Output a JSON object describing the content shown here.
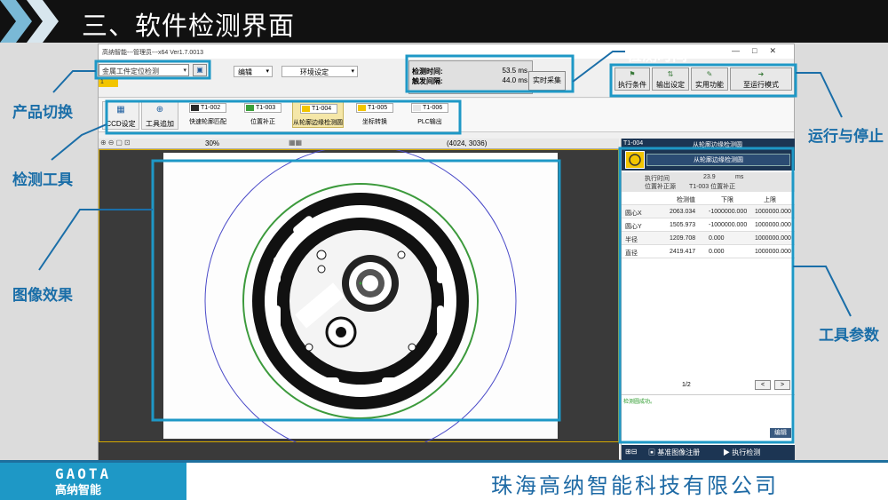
{
  "slide": {
    "title": "三、软件检测界面",
    "company": "珠海高纳智能科技有限公司",
    "logo_en": "GAOTA",
    "logo_cn": "高纳智能"
  },
  "annotations": {
    "product_switch": "产品切换",
    "detection_tools": "检测工具",
    "image_effect": "图像效果",
    "detection_time": "检测时间",
    "run_stop": "运行与停止",
    "tool_params": "工具参数"
  },
  "window": {
    "title": "高纳智能---管理员---x64 Ver1.7.0013",
    "controls": [
      "—",
      "□",
      "✕"
    ]
  },
  "toolbar": {
    "product_value": "金属工件定位检测",
    "badge": "1",
    "edit_menu": "编辑",
    "env_menu": "环境设定",
    "detect_time_label": "检测时间:",
    "detect_time_value": "53.5 ms",
    "trigger_label": "触发间隔:",
    "trigger_value": "44.0 ms",
    "realtime_btn": "实时采集",
    "run_buttons": [
      "执行条件",
      "输出设定",
      "实用功能",
      "至运行模式"
    ]
  },
  "tools": {
    "ccd": "CCD设定",
    "add": "工具追加",
    "items": [
      {
        "id": "T1-002",
        "name": "快速轮廓匹配",
        "color": "#2a2a2a"
      },
      {
        "id": "T1-003",
        "name": "位置补正",
        "color": "#3aa03a"
      },
      {
        "id": "T1-004",
        "name": "从轮廓边缘检测圆",
        "color": "#f2c500"
      },
      {
        "id": "T1-005",
        "name": "坐标转换",
        "color": "#f2c500"
      },
      {
        "id": "T1-006",
        "name": "PLC输出",
        "color": "#e8e8e8"
      }
    ]
  },
  "image": {
    "zoom": "30%",
    "coords": "(4024, 3036)"
  },
  "panel": {
    "head_id": "T1-004",
    "head_title": "从轮廓边缘检测圆",
    "tool_name": "从轮廓边缘检测圆",
    "exec_time_label": "执行时间",
    "exec_time_value": "23.9",
    "exec_time_unit": "ms",
    "pos_label": "位置补正源",
    "pos_value": "T1-003 位置补正",
    "columns": [
      "检测值",
      "下限",
      "上限"
    ],
    "rows": [
      {
        "name": "圆心X",
        "value": "2063.034",
        "low": "-1000000.000",
        "high": "1000000.000"
      },
      {
        "name": "圆心Y",
        "value": "1505.973",
        "low": "-1000000.000",
        "high": "1000000.000"
      },
      {
        "name": "半径",
        "value": "1209.708",
        "low": "0.000",
        "high": "1000000.000"
      },
      {
        "name": "直径",
        "value": "2419.417",
        "low": "0.000",
        "high": "1000000.000"
      }
    ],
    "page": "1/2",
    "prev": "<",
    "next": ">",
    "log": "检测圆成功。",
    "edit": "编辑",
    "register": "基准图像注册",
    "execute": "执行检测"
  },
  "colors": {
    "accent": "#1a6ea8",
    "highlight_box": "#1e98c6",
    "panel_dark": "#1c3553"
  }
}
